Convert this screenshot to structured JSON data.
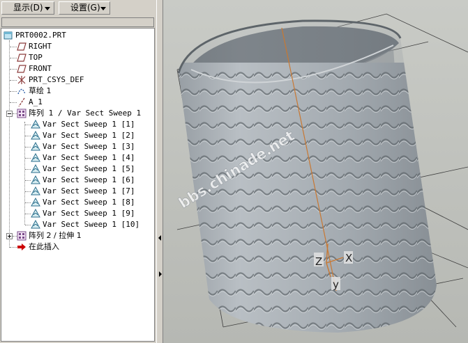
{
  "toolbar": {
    "display_label": "显示(D)",
    "settings_label": "设置(G)"
  },
  "tree": {
    "root": "PRT0002.PRT",
    "items": [
      {
        "label": "RIGHT",
        "icon": "datum-plane-icon"
      },
      {
        "label": "TOP",
        "icon": "datum-plane-icon"
      },
      {
        "label": "FRONT",
        "icon": "datum-plane-icon"
      },
      {
        "label": "PRT_CSYS_DEF",
        "icon": "coordinate-system-icon"
      },
      {
        "label": "草绘 1",
        "icon": "sketch-icon"
      },
      {
        "label": "A_1",
        "icon": "datum-axis-icon"
      }
    ],
    "pattern1": {
      "label": "阵列 1 / Var Sect Sweep 1",
      "children": [
        "Var Sect Sweep 1 [1]",
        "Var Sect Sweep 1 [2]",
        "Var Sect Sweep 1 [3]",
        "Var Sect Sweep 1 [4]",
        "Var Sect Sweep 1 [5]",
        "Var Sect Sweep 1 [6]",
        "Var Sect Sweep 1 [7]",
        "Var Sect Sweep 1 [8]",
        "Var Sect Sweep 1 [9]",
        "Var Sect Sweep 1 [10]"
      ]
    },
    "pattern2": {
      "label": "阵列 2 / 拉伸 1"
    },
    "insert_here": "在此插入"
  },
  "viewport": {
    "watermark": "bbs.chinade.net",
    "axis_z": "Z",
    "axis_x": "X",
    "axis_y": "y"
  },
  "colors": {
    "background": "#d4d0c8",
    "viewport_bg": "#bfc1bc",
    "model_gray": "#a7adb3",
    "axis_orange": "#c87832",
    "insert_arrow": "#cc0000"
  }
}
